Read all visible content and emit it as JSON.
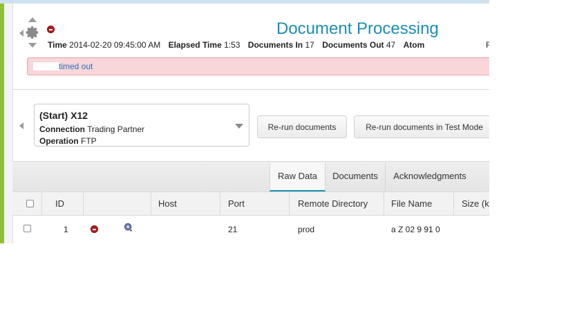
{
  "header": {
    "title": "Document Processing",
    "time_label": "Time",
    "time_value": "2014-02-20 09:45:00 AM",
    "elapsed_label": "Elapsed Time",
    "elapsed_value": "1:53",
    "docs_in_label": "Documents In",
    "docs_in_value": "17",
    "docs_out_label": "Documents Out",
    "docs_out_value": "47",
    "atom_label": "Atom",
    "truncated_right": "F"
  },
  "alert": {
    "message": "timed out"
  },
  "step": {
    "name": "(Start) X12",
    "connection_label": "Connection",
    "connection_value": "Trading Partner",
    "operation_label": "Operation",
    "operation_value": "FTP"
  },
  "buttons": {
    "rerun": "Re-run documents",
    "rerun_test": "Re-run documents in Test Mode"
  },
  "tabs": [
    {
      "label": "Raw Data",
      "active": true
    },
    {
      "label": "Documents",
      "active": false
    },
    {
      "label": "Acknowledgments",
      "active": false
    }
  ],
  "table": {
    "columns": [
      "ID",
      "Host",
      "Port",
      "Remote Directory",
      "File Name",
      "Size (k"
    ],
    "rows": [
      {
        "id": "1",
        "host": "",
        "port": "21",
        "remote_directory": "prod",
        "file_name": "a Z 02 9 91 0"
      }
    ]
  },
  "colors": {
    "title": "#1a8fb0",
    "error": "#b71c1c",
    "alert_bg": "#f9d6d9",
    "link": "#2a6fb6"
  }
}
